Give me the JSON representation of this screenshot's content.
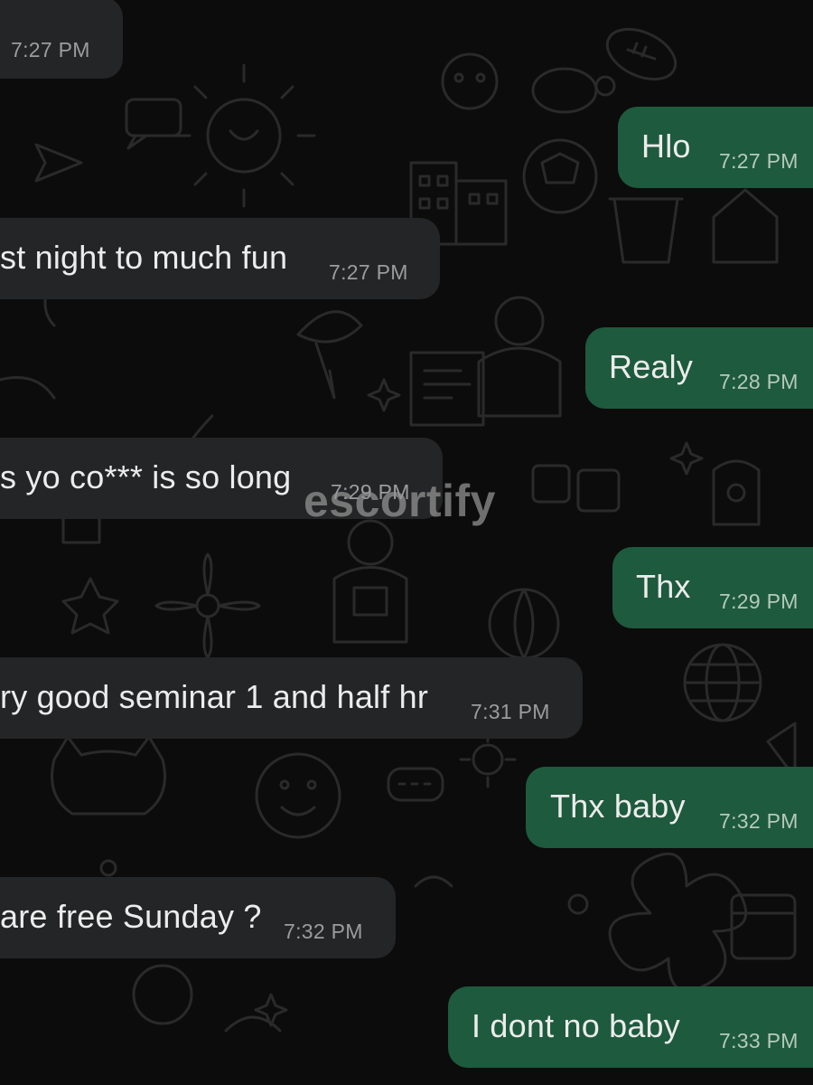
{
  "messages": [
    {
      "direction": "in",
      "text": "",
      "time": "7:27 PM"
    },
    {
      "direction": "out",
      "text": "Hlo",
      "time": "7:27 PM"
    },
    {
      "direction": "in",
      "text": "st night to much fun",
      "time": "7:27 PM"
    },
    {
      "direction": "out",
      "text": "Realy",
      "time": "7:28 PM"
    },
    {
      "direction": "in",
      "text": "s yo co*** is so long",
      "time": "7:29 PM"
    },
    {
      "direction": "out",
      "text": "Thx",
      "time": "7:29 PM"
    },
    {
      "direction": "in",
      "text": "ry good seminar 1 and half hr",
      "time": "7:31 PM"
    },
    {
      "direction": "out",
      "text": "Thx baby",
      "time": "7:32 PM"
    },
    {
      "direction": "in",
      "text": "are free Sunday ?",
      "time": "7:32 PM"
    },
    {
      "direction": "out",
      "text": "I dont no baby",
      "time": "7:33 PM"
    }
  ],
  "watermark": "escortify",
  "colors": {
    "background": "#0c0c0c",
    "incoming_bubble": "#242526",
    "outgoing_bubble": "#1e5a3d",
    "text": "#ececec",
    "timestamp": "#9a9c9e"
  }
}
